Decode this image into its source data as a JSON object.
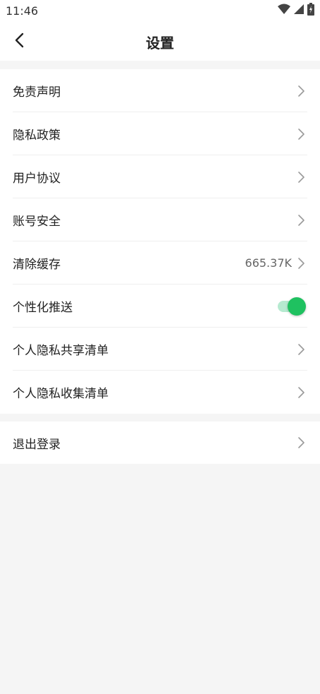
{
  "status_bar": {
    "time": "11:46",
    "icons": [
      "wifi-icon",
      "cellular-signal-icon",
      "battery-charging-icon"
    ]
  },
  "header": {
    "back_icon": "chevron-left-icon",
    "title": "设置"
  },
  "settings_group": {
    "items": [
      {
        "label": "免责声明",
        "action": "chevron"
      },
      {
        "label": "隐私政策",
        "action": "chevron"
      },
      {
        "label": "用户协议",
        "action": "chevron"
      },
      {
        "label": "账号安全",
        "action": "chevron"
      },
      {
        "label": "清除缓存",
        "value": "665.37K",
        "action": "chevron"
      },
      {
        "label": "个性化推送",
        "action": "toggle",
        "toggle_on": true
      },
      {
        "label": "个人隐私共享清单",
        "action": "chevron"
      },
      {
        "label": "个人隐私收集清单",
        "action": "chevron"
      }
    ]
  },
  "logout_group": {
    "label": "退出登录"
  },
  "colors": {
    "accent": "#1fc160",
    "toggle_track": "#b6ead0",
    "chevron": "#9a9a9a",
    "background": "#f5f5f5"
  }
}
